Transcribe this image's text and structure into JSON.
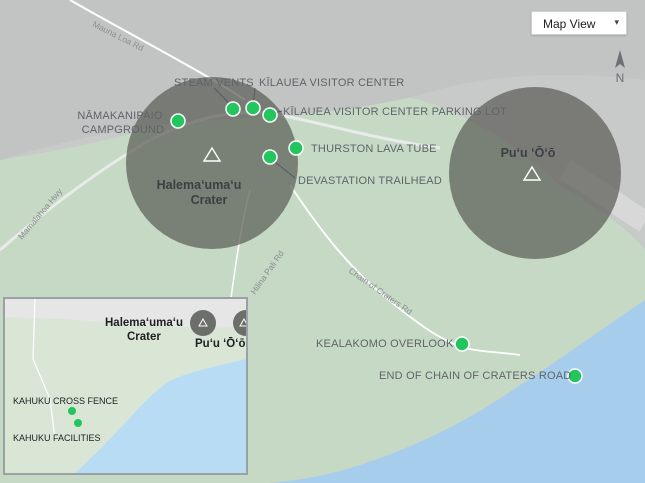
{
  "controls": {
    "map_view_label": "Map View",
    "map_view_chevron_icon": "chevron-down-icon",
    "compass_label": "N"
  },
  "roads": {
    "mauna_loa": "Mauna Loa Rd",
    "mamalahoa": "Mamalahoa Hwy",
    "hilina_pali": "Hilina Pali Rd",
    "chain_of_craters": "Chain of Craters Rd"
  },
  "craters": {
    "halemaumau_line1": "Halema‘uma‘u",
    "halemaumau_line2": "Crater",
    "puu_oo": "Pu‘u ‘Ō‘ō"
  },
  "points": {
    "namakanipaio_line1": "NĀMAKANIPAIO",
    "namakanipaio_line2": "CAMPGROUND",
    "steam_vents": "STEAM VENTS",
    "visitor_center": "KĪLAUEA VISITOR CENTER",
    "parking_lot": "KĪLAUEA VISITOR CENTER PARKING LOT",
    "thurston": "THURSTON LAVA TUBE",
    "devastation": "DEVASTATION TRAILHEAD",
    "kealakomo": "KEALAKOMO OVERLOOK",
    "end_chain": "END OF CHAIN OF CRATERS ROAD"
  },
  "inset": {
    "halemaumau_line1": "Halema‘uma‘u",
    "halemaumau_line2": "Crater",
    "puu_oo": "Pu‘u ‘Ō‘ō",
    "kahuku_cross_fence": "KAHUKU CROSS FENCE",
    "kahuku_facilities": "KAHUKU FACILITIES"
  },
  "colors": {
    "land_gray": "#c8c9c9",
    "park_green": "#c6d9c5",
    "ocean": "#a7cdec",
    "crater_fill": "#5b5d58",
    "poi_green": "#22c55e"
  }
}
